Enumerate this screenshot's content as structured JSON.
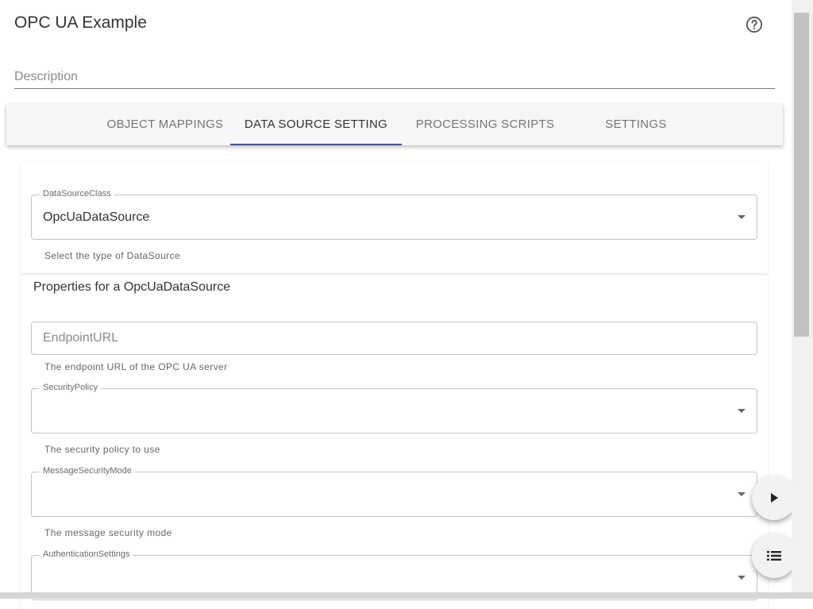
{
  "header": {
    "title": "OPC UA Example"
  },
  "description": {
    "placeholder": "Description"
  },
  "tabs": [
    {
      "label": "OBJECT MAPPINGS",
      "active": false
    },
    {
      "label": "DATA SOURCE SETTING",
      "active": true
    },
    {
      "label": "PROCESSING SCRIPTS",
      "active": false
    },
    {
      "label": "SETTINGS",
      "active": false
    }
  ],
  "datasource": {
    "label": "DataSourceClass",
    "value": "OpcUaDataSource",
    "helper": "Select the type of DataSource"
  },
  "properties": {
    "title": "Properties for a OpcUaDataSource",
    "endpoint": {
      "placeholder": "EndpointURL",
      "helper": "The endpoint URL of the OPC UA server"
    },
    "security_policy": {
      "label": "SecurityPolicy",
      "value": "",
      "helper": "The security policy to use"
    },
    "message_security_mode": {
      "label": "MessageSecurityMode",
      "value": "",
      "helper": "The message security mode"
    },
    "authentication_settings": {
      "label": "AuthenticationSettings",
      "value": ""
    }
  },
  "icons": {
    "help": "help-circle-icon",
    "play": "play-icon",
    "list": "list-icon",
    "dropdown": "chevron-down-icon"
  },
  "colors": {
    "accent": "#3f51b5"
  }
}
